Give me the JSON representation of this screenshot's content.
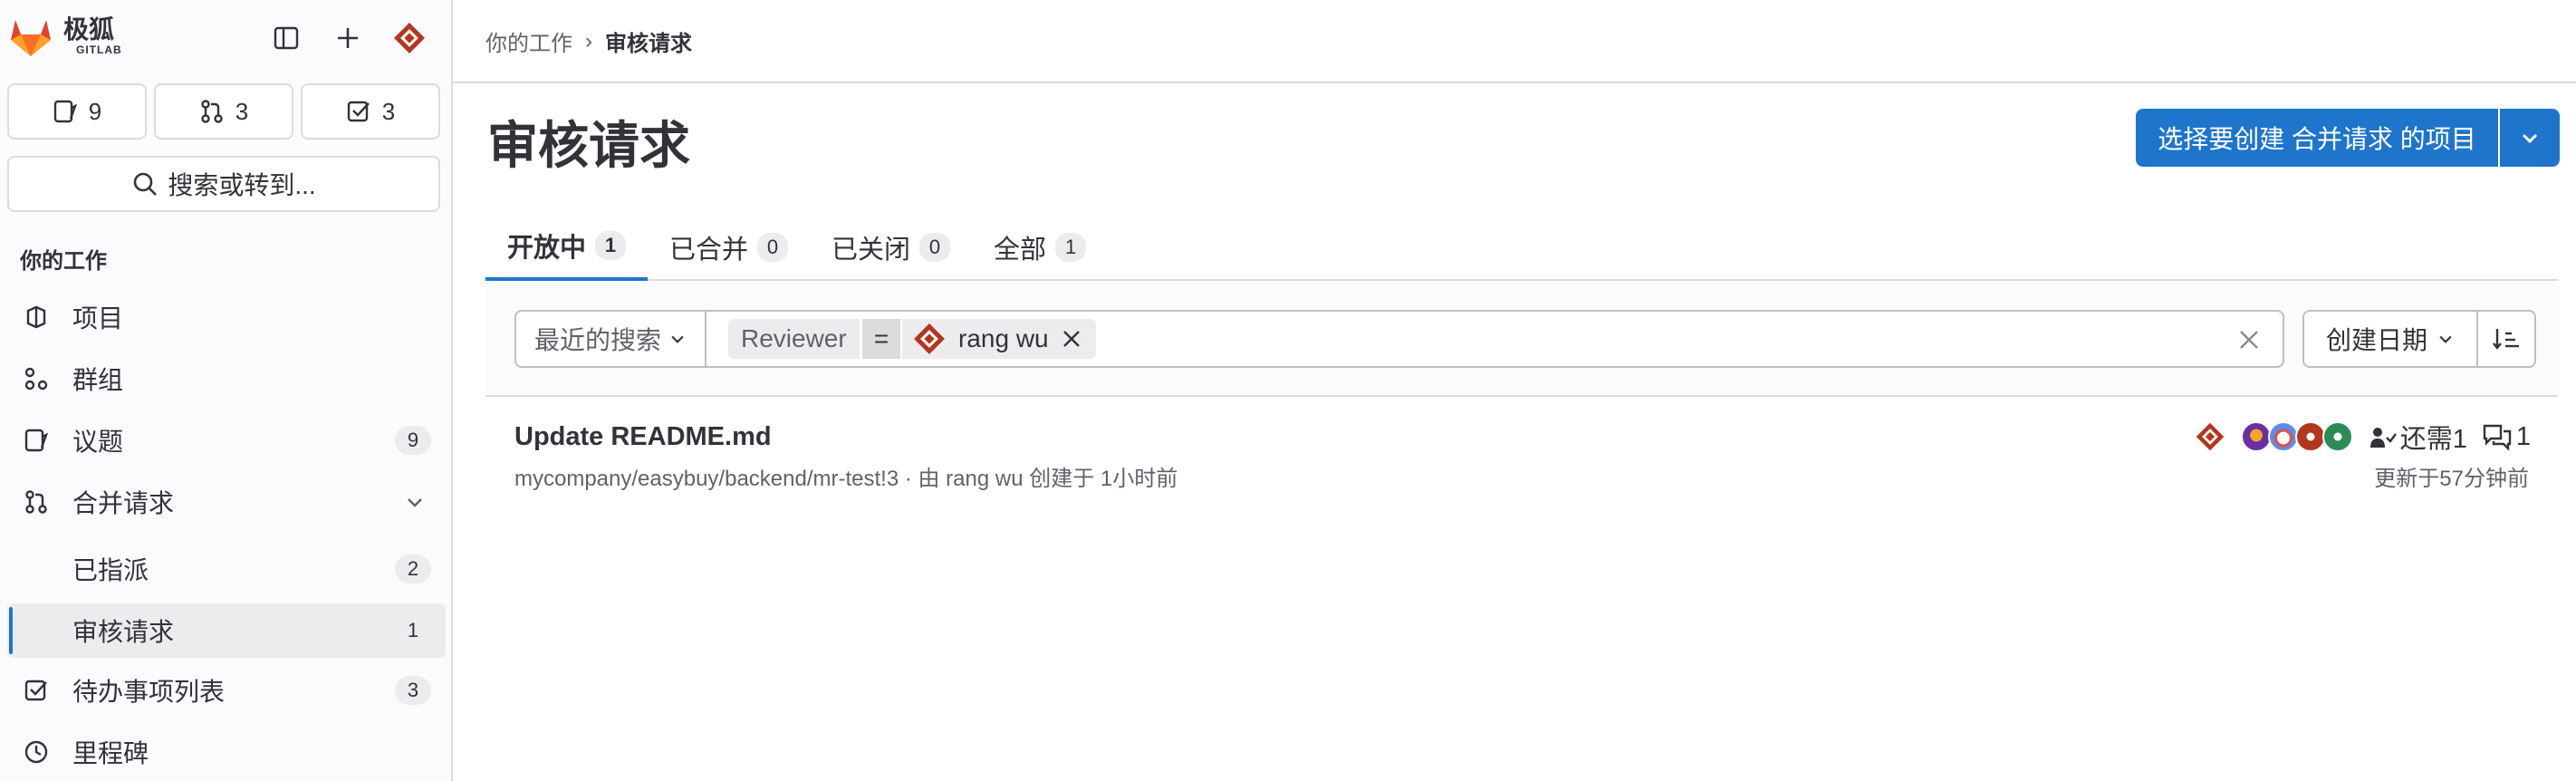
{
  "brand": {
    "name": "极狐",
    "sub": "GITLAB"
  },
  "counters": {
    "issues": "9",
    "merge_requests": "3",
    "todos": "3"
  },
  "search": {
    "label": "搜索或转到..."
  },
  "sidebar": {
    "section_title": "你的工作",
    "items": [
      {
        "label": "项目"
      },
      {
        "label": "群组"
      },
      {
        "label": "议题",
        "count": "9"
      },
      {
        "label": "合并请求"
      },
      {
        "label": "已指派",
        "count": "2"
      },
      {
        "label": "审核请求",
        "count": "1"
      },
      {
        "label": "待办事项列表",
        "count": "3"
      },
      {
        "label": "里程碑"
      }
    ]
  },
  "breadcrumb": {
    "parent": "你的工作",
    "separator": "›",
    "current": "审核请求"
  },
  "page": {
    "title": "审核请求",
    "primary_button": "选择要创建 合并请求 的项目"
  },
  "tabs": [
    {
      "label": "开放中",
      "count": "1"
    },
    {
      "label": "已合并",
      "count": "0"
    },
    {
      "label": "已关闭",
      "count": "0"
    },
    {
      "label": "全部",
      "count": "1"
    }
  ],
  "filter": {
    "recent_label": "最近的搜索",
    "token_key": "Reviewer",
    "token_op": "=",
    "token_value": "rang wu",
    "sort_label": "创建日期"
  },
  "merge_request": {
    "title": "Update README.md",
    "meta": "mycompany/easybuy/backend/mr-test!3 · 由 rang wu 创建于 1小时前",
    "approvals_needed": "还需1",
    "comments": "1",
    "updated": "更新于57分钟前"
  },
  "colors": {
    "accent": "#1f75cb",
    "fox_orange": "#e24329",
    "avatar_red": "#b3361f"
  }
}
